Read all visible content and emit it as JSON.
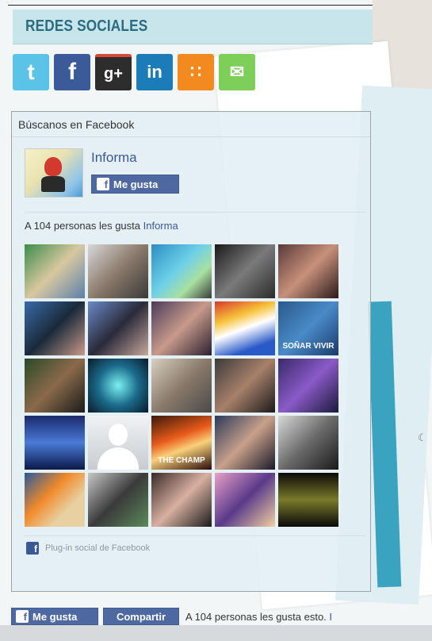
{
  "section_title": "REDES SOCIALES",
  "social_icons": [
    {
      "name": "twitter-icon",
      "glyph": "t",
      "color": "#5cc3e8"
    },
    {
      "name": "facebook-icon",
      "glyph": "f",
      "color": "#3b5a9a"
    },
    {
      "name": "google-plus-icon",
      "glyph": "g+",
      "color": "#2d2d2d"
    },
    {
      "name": "linkedin-icon",
      "glyph": "in",
      "color": "#1b7cb7"
    },
    {
      "name": "rss-icon",
      "glyph": "∷",
      "color": "#f28a20"
    },
    {
      "name": "mail-icon",
      "glyph": "✉",
      "color": "#7dcf5a"
    }
  ],
  "facebook_box": {
    "title": "Búscanos en Facebook",
    "page_name": "Informa",
    "like_button": "Me gusta",
    "likes_prefix": "A 104 personas les gusta",
    "likes_link": "Informa",
    "plugin_label": "Plug-in social de Facebook",
    "faces": [
      {
        "label": "",
        "bg": "linear-gradient(135deg,#3c8c4a,#d8c8a0 50%,#5a7fa8)"
      },
      {
        "label": "",
        "bg": "linear-gradient(135deg,#d8d8d8,#8a7a6a 50%,#3a3a3a)"
      },
      {
        "label": "",
        "bg": "linear-gradient(135deg,#2a8ec4,#6fd0e8 45%,#a8e0a0 70%,#3a3a3a)"
      },
      {
        "label": "",
        "bg": "linear-gradient(135deg,#1a1a1a,#7a7a7a 50%,#2a2a2a)"
      },
      {
        "label": "",
        "bg": "linear-gradient(135deg,#5a3a3a,#c8907a 50%,#2a1a1a)"
      },
      {
        "label": "",
        "bg": "linear-gradient(135deg,#3a6aa8,#1a2a3a 50%,#c89a8a)"
      },
      {
        "label": "",
        "bg": "linear-gradient(135deg,#6a8ac8,#2a2a3a 50%,#c8a89a)"
      },
      {
        "label": "",
        "bg": "linear-gradient(135deg,#4a3a5a,#c89a8a 50%,#2a2030)"
      },
      {
        "label": "",
        "bg": "linear-gradient(160deg,#d83a2a,#f6c23a 30%,#ffffff 50%,#2a5ac8 80%)"
      },
      {
        "label": "SOÑAR VIVIR",
        "bg": "linear-gradient(135deg,#2a5a8a,#4a8ac8 50%,#1a3a6a)"
      },
      {
        "label": "",
        "bg": "linear-gradient(135deg,#2a4a2a,#8a6a4a 50%,#1a1a1a)"
      },
      {
        "label": "",
        "bg": "radial-gradient(circle,#7af0f0,#1a6a8a 50%,#0a1a2a)"
      },
      {
        "label": "",
        "bg": "linear-gradient(135deg,#d8d0c0,#8a7a6a 50%,#4a4a4a)"
      },
      {
        "label": "",
        "bg": "linear-gradient(135deg,#3a3a3a,#a8806a 50%,#1a1a1a)"
      },
      {
        "label": "",
        "bg": "linear-gradient(135deg,#3a2a6a,#8a5ac8 50%,#1a1a3a)"
      },
      {
        "label": "",
        "bg": "linear-gradient(180deg,#1a2a6a,#4a7ad8 50%,#0a1a4a)"
      },
      {
        "label": "",
        "bg": "linear-gradient(180deg,#f0f2f4,#c8ccd0)"
      },
      {
        "label": "THE CHAMP",
        "bg": "linear-gradient(160deg,#3a1a0a,#e85a1a 40%,#f8d07a 60%,#2a0a0a)"
      },
      {
        "label": "",
        "bg": "linear-gradient(135deg,#2a3a5a,#c8a08a 50%,#1a1a2a)"
      },
      {
        "label": "",
        "bg": "linear-gradient(135deg,#d8d8d8,#6a6a6a 50%,#1a1a1a)"
      },
      {
        "label": "",
        "bg": "linear-gradient(135deg,#2a5a9a,#f08a2a 40%,#e8d0a0 70%)"
      },
      {
        "label": "",
        "bg": "linear-gradient(135deg,#c8c8c8,#3a3a3a 50%,#5a8a5a)"
      },
      {
        "label": "",
        "bg": "linear-gradient(135deg,#3a2a2a,#d8b0a0 50%,#1a1a1a)"
      },
      {
        "label": "",
        "bg": "linear-gradient(135deg,#e8a0c8,#5a3a8a 50%,#f0d0a0)"
      },
      {
        "label": "",
        "bg": "linear-gradient(180deg,#0a0a0a,#7a7a2a 50%,#0a0a0a)"
      }
    ]
  },
  "bottom_bar": {
    "like_button": "Me gusta",
    "share_button": "Compartir",
    "text": "A 104 personas les gusta esto.",
    "trailing": "I"
  }
}
